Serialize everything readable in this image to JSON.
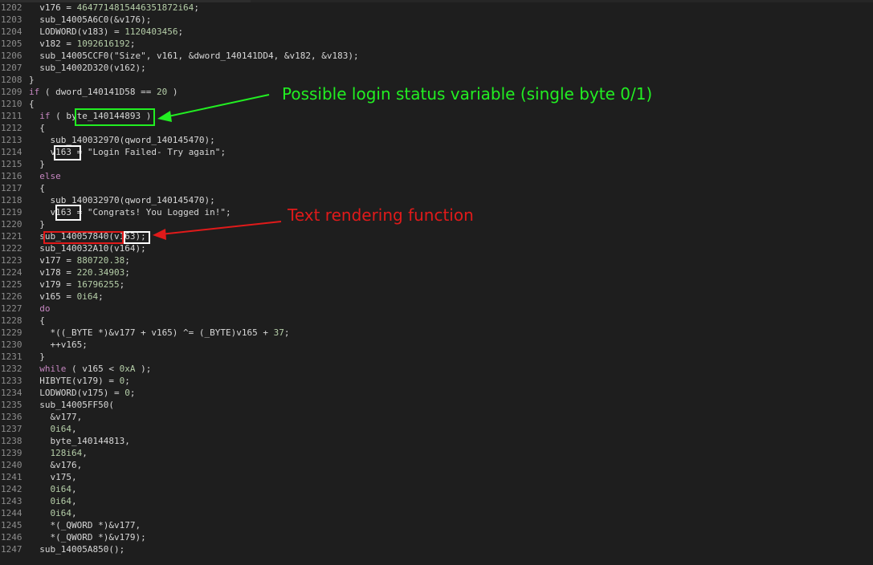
{
  "colors": {
    "background": "#1e1e1e",
    "line_number": "#8c8c8c",
    "code_text": "#d8d8d8",
    "keyword": "#c586c0",
    "number": "#b5cea8",
    "string": "#d8d8d8",
    "highlight_green": "#22ee22",
    "highlight_red": "#e01a1a",
    "highlight_white": "#ffffff"
  },
  "lines": [
    {
      "num": "1202",
      "code": "  v176 = 4647714815446351872i64;"
    },
    {
      "num": "1203",
      "code": "  sub_14005A6C0(&v176);"
    },
    {
      "num": "1204",
      "code": "  LODWORD(v183) = 1120403456;"
    },
    {
      "num": "1205",
      "code": "  v182 = 1092616192;"
    },
    {
      "num": "1206",
      "code": "  sub_14005CCF0(\"Size\", v161, &dword_140141DD4, &v182, &v183);"
    },
    {
      "num": "1207",
      "code": "  sub_14002D320(v162);"
    },
    {
      "num": "1208",
      "code": "}"
    },
    {
      "num": "1209",
      "code": "if ( dword_140141D58 == 20 )"
    },
    {
      "num": "1210",
      "code": "{"
    },
    {
      "num": "1211",
      "code": "  if ( byte_140144893 )"
    },
    {
      "num": "1212",
      "code": "  {"
    },
    {
      "num": "1213",
      "code": "    sub_140032970(qword_140145470);"
    },
    {
      "num": "1214",
      "code": "    v163 = \"Login Failed- Try again\";"
    },
    {
      "num": "1215",
      "code": "  }"
    },
    {
      "num": "1216",
      "code": "  else"
    },
    {
      "num": "1217",
      "code": "  {"
    },
    {
      "num": "1218",
      "code": "    sub_140032970(qword_140145470);"
    },
    {
      "num": "1219",
      "code": "    v163 = \"Congrats! You Logged in!\";"
    },
    {
      "num": "1220",
      "code": "  }"
    },
    {
      "num": "1221",
      "code": "  sub_140057840(v163);"
    },
    {
      "num": "1222",
      "code": "  sub_140032A10(v164);"
    },
    {
      "num": "1223",
      "code": "  v177 = 880720.38;"
    },
    {
      "num": "1224",
      "code": "  v178 = 220.34903;"
    },
    {
      "num": "1225",
      "code": "  v179 = 16796255;"
    },
    {
      "num": "1226",
      "code": "  v165 = 0i64;"
    },
    {
      "num": "1227",
      "code": "  do"
    },
    {
      "num": "1228",
      "code": "  {"
    },
    {
      "num": "1229",
      "code": "    *((_BYTE *)&v177 + v165) ^= (_BYTE)v165 + 37;"
    },
    {
      "num": "1230",
      "code": "    ++v165;"
    },
    {
      "num": "1231",
      "code": "  }"
    },
    {
      "num": "1232",
      "code": "  while ( v165 < 0xA );"
    },
    {
      "num": "1233",
      "code": "  HIBYTE(v179) = 0;"
    },
    {
      "num": "1234",
      "code": "  LODWORD(v175) = 0;"
    },
    {
      "num": "1235",
      "code": "  sub_14005FF50("
    },
    {
      "num": "1236",
      "code": "    &v177,"
    },
    {
      "num": "1237",
      "code": "    0i64,"
    },
    {
      "num": "1238",
      "code": "    byte_140144813,"
    },
    {
      "num": "1239",
      "code": "    128i64,"
    },
    {
      "num": "1240",
      "code": "    &v176,"
    },
    {
      "num": "1241",
      "code": "    v175,"
    },
    {
      "num": "1242",
      "code": "    0i64,"
    },
    {
      "num": "1243",
      "code": "    0i64,"
    },
    {
      "num": "1244",
      "code": "    0i64,"
    },
    {
      "num": "1245",
      "code": "    *(_QWORD *)&v177,"
    },
    {
      "num": "1246",
      "code": "    *(_QWORD *)&v179);"
    },
    {
      "num": "1247",
      "code": "  sub_14005A850();"
    }
  ],
  "annotations": {
    "login_status_label": "Possible login status variable (single byte 0/1)",
    "text_render_label": "Text rendering function"
  }
}
